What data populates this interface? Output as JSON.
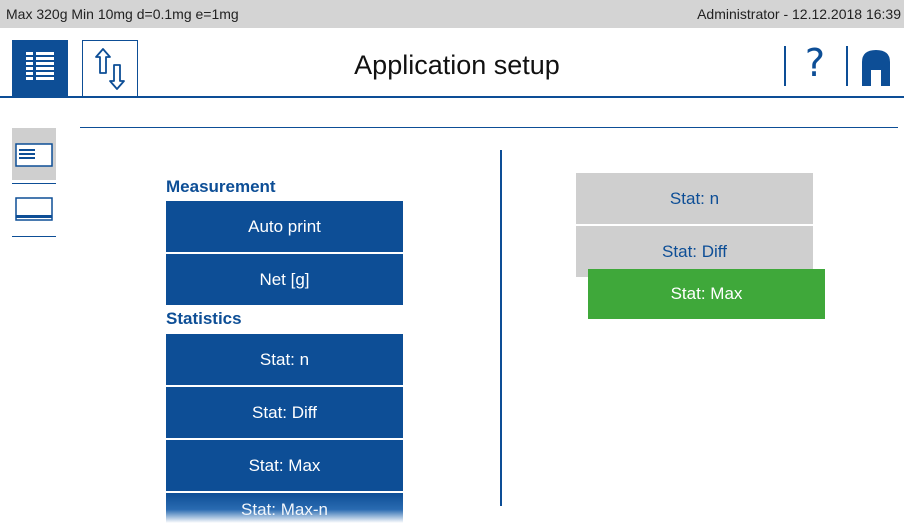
{
  "status_bar": {
    "scale_spec": "Max 320g  Min 10mg  d=0.1mg  e=1mg",
    "user_datetime": "Administrator  -  12.12.2018 16:39"
  },
  "header": {
    "title": "Application setup",
    "help_glyph": "?",
    "menu_icon": "list-menu-icon",
    "swap_icon": "up-down-arrows-icon",
    "home_icon": "home-icon"
  },
  "side_tabs": [
    {
      "icon": "display-settings-icon",
      "selected": true
    },
    {
      "icon": "printout-icon",
      "selected": false
    }
  ],
  "available": {
    "groups": [
      {
        "label": "Measurement",
        "items": [
          "Auto print",
          "Net [g]"
        ]
      },
      {
        "label": "Statistics",
        "items": [
          "Stat: n",
          "Stat: Diff",
          "Stat: Max",
          "Stat: Max-n"
        ]
      }
    ]
  },
  "selected": {
    "items": [
      "Stat: n",
      "Stat: Diff",
      "Stat: Max"
    ],
    "active_index": 2
  },
  "colors": {
    "brand_blue": "#0d4e96",
    "active_green": "#3fa83a",
    "inactive_gray": "#cfcfcf",
    "status_bar": "#d4d4d4"
  }
}
